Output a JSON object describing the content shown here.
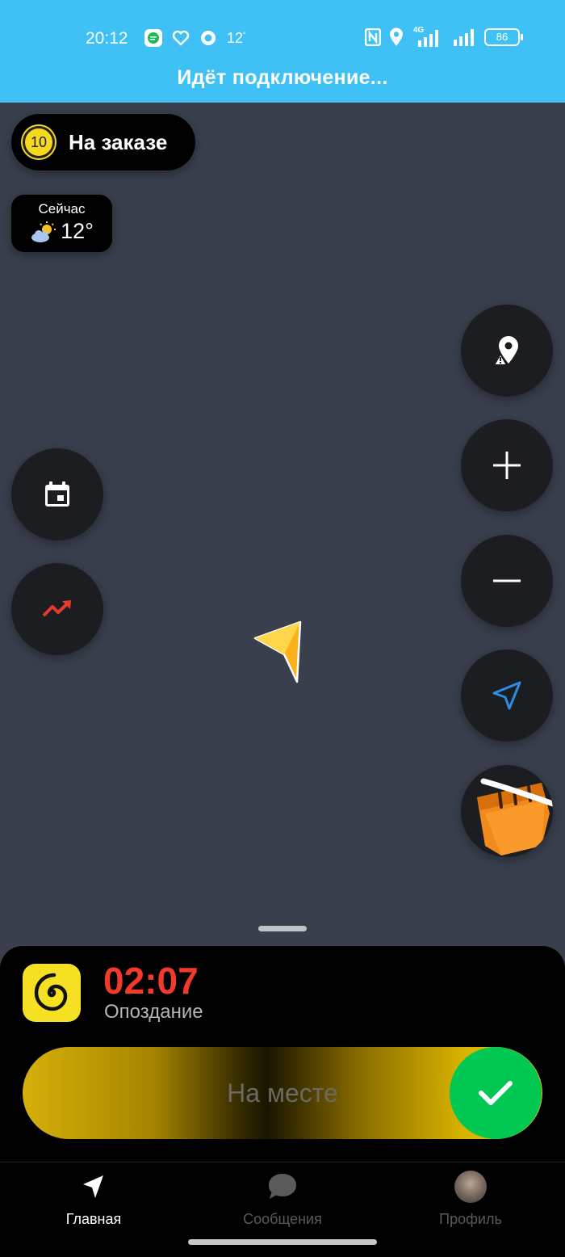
{
  "status_bar": {
    "time": "20:12",
    "temperature": "12",
    "temperature_unit": "°",
    "network": "4G",
    "battery": "86"
  },
  "connection_banner": "Идёт подключение...",
  "order_status": {
    "badge_number": "10",
    "label": "На заказе"
  },
  "weather": {
    "label": "Сейчас",
    "temperature": "12°",
    "icon": "partly-cloudy-icon"
  },
  "map_controls": {
    "icons": [
      "report-location-icon",
      "zoom-in-icon",
      "zoom-out-icon",
      "navigate-icon",
      "basket-icon"
    ]
  },
  "left_controls": {
    "icons": [
      "calendar-icon",
      "surge-trend-icon"
    ]
  },
  "order_panel": {
    "timer": "02:07",
    "timer_status": "Опоздание",
    "slider_label": "На месте",
    "timer_color": "#f33a2a",
    "confirm_color": "#00c853"
  },
  "tabs": [
    {
      "label": "Главная",
      "icon": "navigation-arrow-icon",
      "active": true
    },
    {
      "label": "Сообщения",
      "icon": "chat-bubble-icon",
      "active": false
    },
    {
      "label": "Профиль",
      "icon": "avatar",
      "active": false
    }
  ],
  "colors": {
    "status_bar": "#3fc1f5",
    "map_background": "#393f4d",
    "accent_yellow": "#f5d820"
  }
}
